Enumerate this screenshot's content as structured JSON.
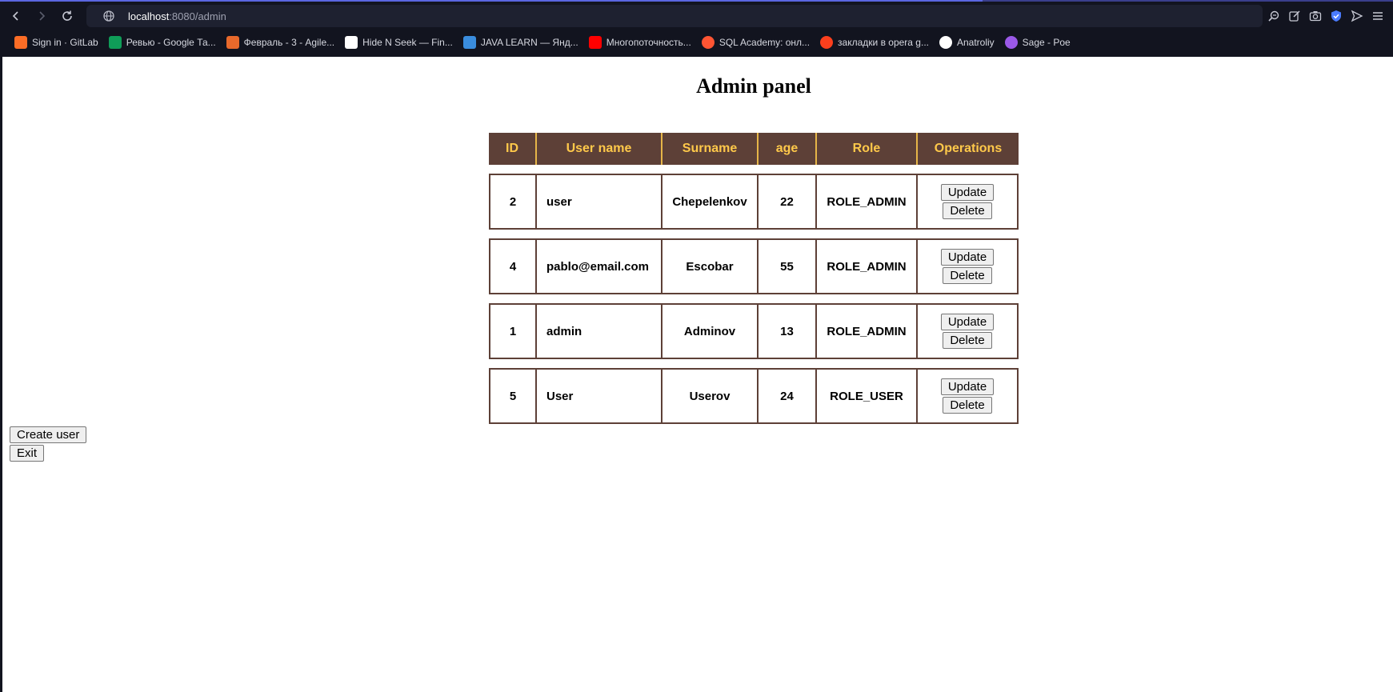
{
  "browser": {
    "url_host": "localhost",
    "url_path": ":8080/admin",
    "bookmarks": [
      {
        "label": "Sign in · GitLab",
        "icon": "gitlab-icon",
        "color": "#fc6d26"
      },
      {
        "label": "Ревью - Google Та...",
        "icon": "google-sheets-icon",
        "color": "#0f9d58"
      },
      {
        "label": "Февраль - 3 - Agile...",
        "icon": "agile-icon",
        "color": "#e8692b"
      },
      {
        "label": "Hide N Seek — Fin...",
        "icon": "play-icon",
        "color": "#ffffff"
      },
      {
        "label": "JAVA LEARN — Янд...",
        "icon": "yandex-disk-icon",
        "color": "#3a8dde"
      },
      {
        "label": "Многопоточность...",
        "icon": "youtube-icon",
        "color": "#ff0000"
      },
      {
        "label": "SQL Academy: онл...",
        "icon": "sql-academy-icon",
        "color": "#ff5533"
      },
      {
        "label": "закладки в opera g...",
        "icon": "yandex-icon",
        "color": "#fc3f1d"
      },
      {
        "label": "Anatroliy",
        "icon": "github-icon",
        "color": "#ffffff"
      },
      {
        "label": "Sage - Poe",
        "icon": "poe-icon",
        "color": "#9b59e8"
      }
    ]
  },
  "page": {
    "title": "Admin panel",
    "table": {
      "headers": [
        "ID",
        "User name",
        "Surname",
        "age",
        "Role",
        "Operations"
      ],
      "rows": [
        {
          "id": "2",
          "username": "user",
          "surname": "Chepelenkov",
          "age": "22",
          "role": "ROLE_ADMIN"
        },
        {
          "id": "4",
          "username": "pablo@email.com",
          "surname": "Escobar",
          "age": "55",
          "role": "ROLE_ADMIN"
        },
        {
          "id": "1",
          "username": "admin",
          "surname": "Adminov",
          "age": "13",
          "role": "ROLE_ADMIN"
        },
        {
          "id": "5",
          "username": "User",
          "surname": "Userov",
          "age": "24",
          "role": "ROLE_USER"
        }
      ],
      "update_label": "Update",
      "delete_label": "Delete"
    },
    "create_user_label": "Create user",
    "exit_label": "Exit"
  },
  "colors": {
    "header_bg": "#5d4037",
    "header_text": "#ffc94a",
    "border": "#5d4037"
  }
}
